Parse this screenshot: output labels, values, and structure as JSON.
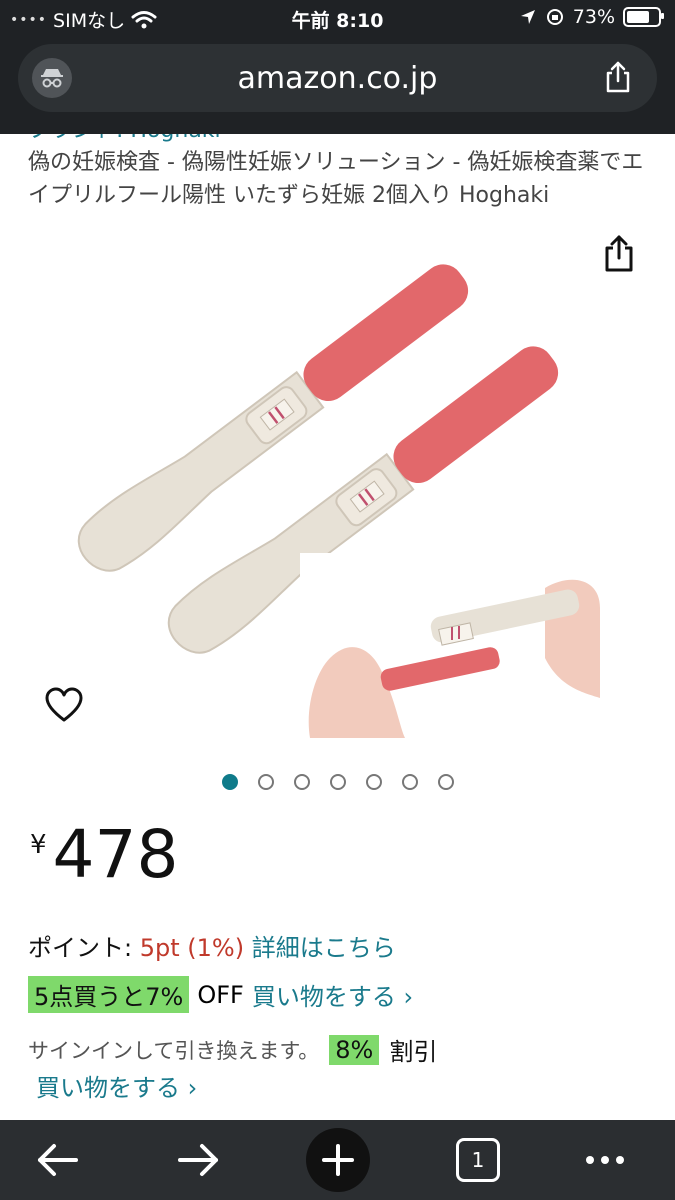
{
  "status_bar": {
    "carrier": "SIMなし",
    "time": "午前 8:10",
    "battery": "73%",
    "battery_level": 0.73
  },
  "browser": {
    "url": "amazon.co.jp",
    "incognito_icon": "incognito-icon",
    "share_icon": "share-icon"
  },
  "product": {
    "brand_cut": "ブランド: Hoghaki",
    "title": "偽の妊娠検査 - 偽陽性妊娠ソリューション - 偽妊娠検査薬でエイプリルフール陽性 いたずら妊娠 2個入り Hoghaki",
    "image_count": 7,
    "active_image": 1
  },
  "price": {
    "currency": "¥",
    "amount": "478"
  },
  "points": {
    "label": "ポイント: ",
    "value": "5pt",
    "percent": "(1%)",
    "link": "詳細はこちら"
  },
  "bulk": {
    "badge": "5点買うと7%",
    "off": "OFF",
    "link": "買い物をする ›"
  },
  "signin": {
    "text": "サインインして引き換えます。",
    "badge": "8%",
    "discount": "割引",
    "link": "買い物をする ›"
  },
  "colors": {
    "accent_link": "#1a7a8c",
    "points_red": "#c0392b",
    "badge_green": "#7fd96b",
    "chrome_dark": "#1f2225"
  },
  "toolbar": {
    "back_icon": "back-arrow-icon",
    "forward_icon": "forward-arrow-icon",
    "new_tab_icon": "plus-icon",
    "tab_count": "1",
    "menu_icon": "more-icon"
  }
}
